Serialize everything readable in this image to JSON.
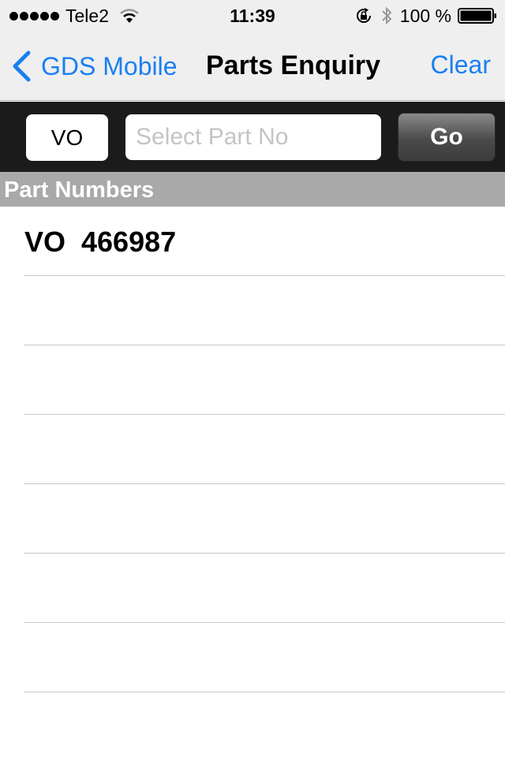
{
  "status_bar": {
    "signal_dots": 5,
    "carrier": "Tele2",
    "wifi_icon": "wifi-icon",
    "time": "11:39",
    "rotation_lock_icon": "rotation-lock-icon",
    "bluetooth_icon": "bluetooth-icon",
    "battery_percent": "100 %",
    "battery_level": 1.0
  },
  "nav": {
    "back_label": "GDS Mobile",
    "title": "Parts Enquiry",
    "clear_label": "Clear"
  },
  "search": {
    "prefix_value": "VO",
    "part_input_value": "",
    "part_input_placeholder": "Select Part No",
    "go_label": "Go"
  },
  "section": {
    "header": "Part Numbers"
  },
  "list": {
    "items": [
      {
        "text": "VO  466987"
      },
      {
        "text": ""
      },
      {
        "text": ""
      },
      {
        "text": ""
      },
      {
        "text": ""
      },
      {
        "text": ""
      },
      {
        "text": ""
      }
    ]
  },
  "colors": {
    "accent": "#1a7ff2",
    "search_bar_bg": "#1b1b1b",
    "section_header_bg": "#a9a9a9",
    "nav_bg": "#efefef",
    "separator": "#c8c7cc"
  }
}
